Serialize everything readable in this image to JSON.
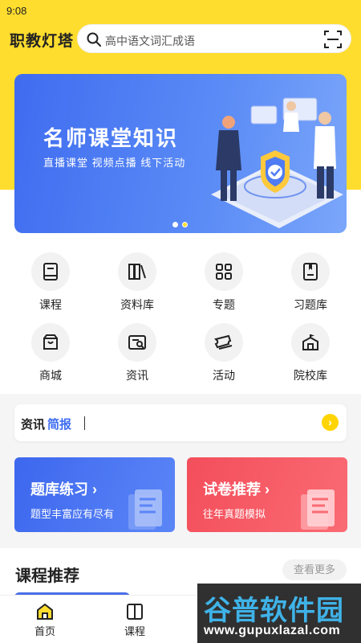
{
  "status_bar": {
    "time": "9:08"
  },
  "header": {
    "app_title": "职教灯塔",
    "search_placeholder": "高中语文词汇成语"
  },
  "banner": {
    "title": "名师课堂知识",
    "subtitle": "直播课堂  视频点播  线下活动"
  },
  "grid": [
    {
      "label": "课程",
      "icon": "book-icon"
    },
    {
      "label": "资料库",
      "icon": "books-icon"
    },
    {
      "label": "专题",
      "icon": "grid-icon"
    },
    {
      "label": "习题库",
      "icon": "exercise-icon"
    },
    {
      "label": "商城",
      "icon": "bag-icon"
    },
    {
      "label": "资讯",
      "icon": "news-icon"
    },
    {
      "label": "活动",
      "icon": "ticket-icon"
    },
    {
      "label": "院校库",
      "icon": "school-icon"
    }
  ],
  "news": {
    "label_a": "资讯",
    "label_b": "简报",
    "arrow": "›"
  },
  "cards": [
    {
      "title": "题库练习 ›",
      "subtitle": "题型丰富应有尽有"
    },
    {
      "title": "试卷推荐 ›",
      "subtitle": "往年真题模拟"
    }
  ],
  "recommend": {
    "title": "课程推荐",
    "more": "查看更多"
  },
  "tabs": [
    {
      "label": "首页",
      "icon": "home-icon"
    },
    {
      "label": "课程",
      "icon": "course-icon"
    }
  ],
  "watermark": {
    "main": "谷普软件园",
    "url": "www.gupuxlazal.com"
  },
  "colors": {
    "brand_yellow": "#FFDD2E",
    "blue": "#3F6CF0",
    "red": "#F34E5B"
  }
}
